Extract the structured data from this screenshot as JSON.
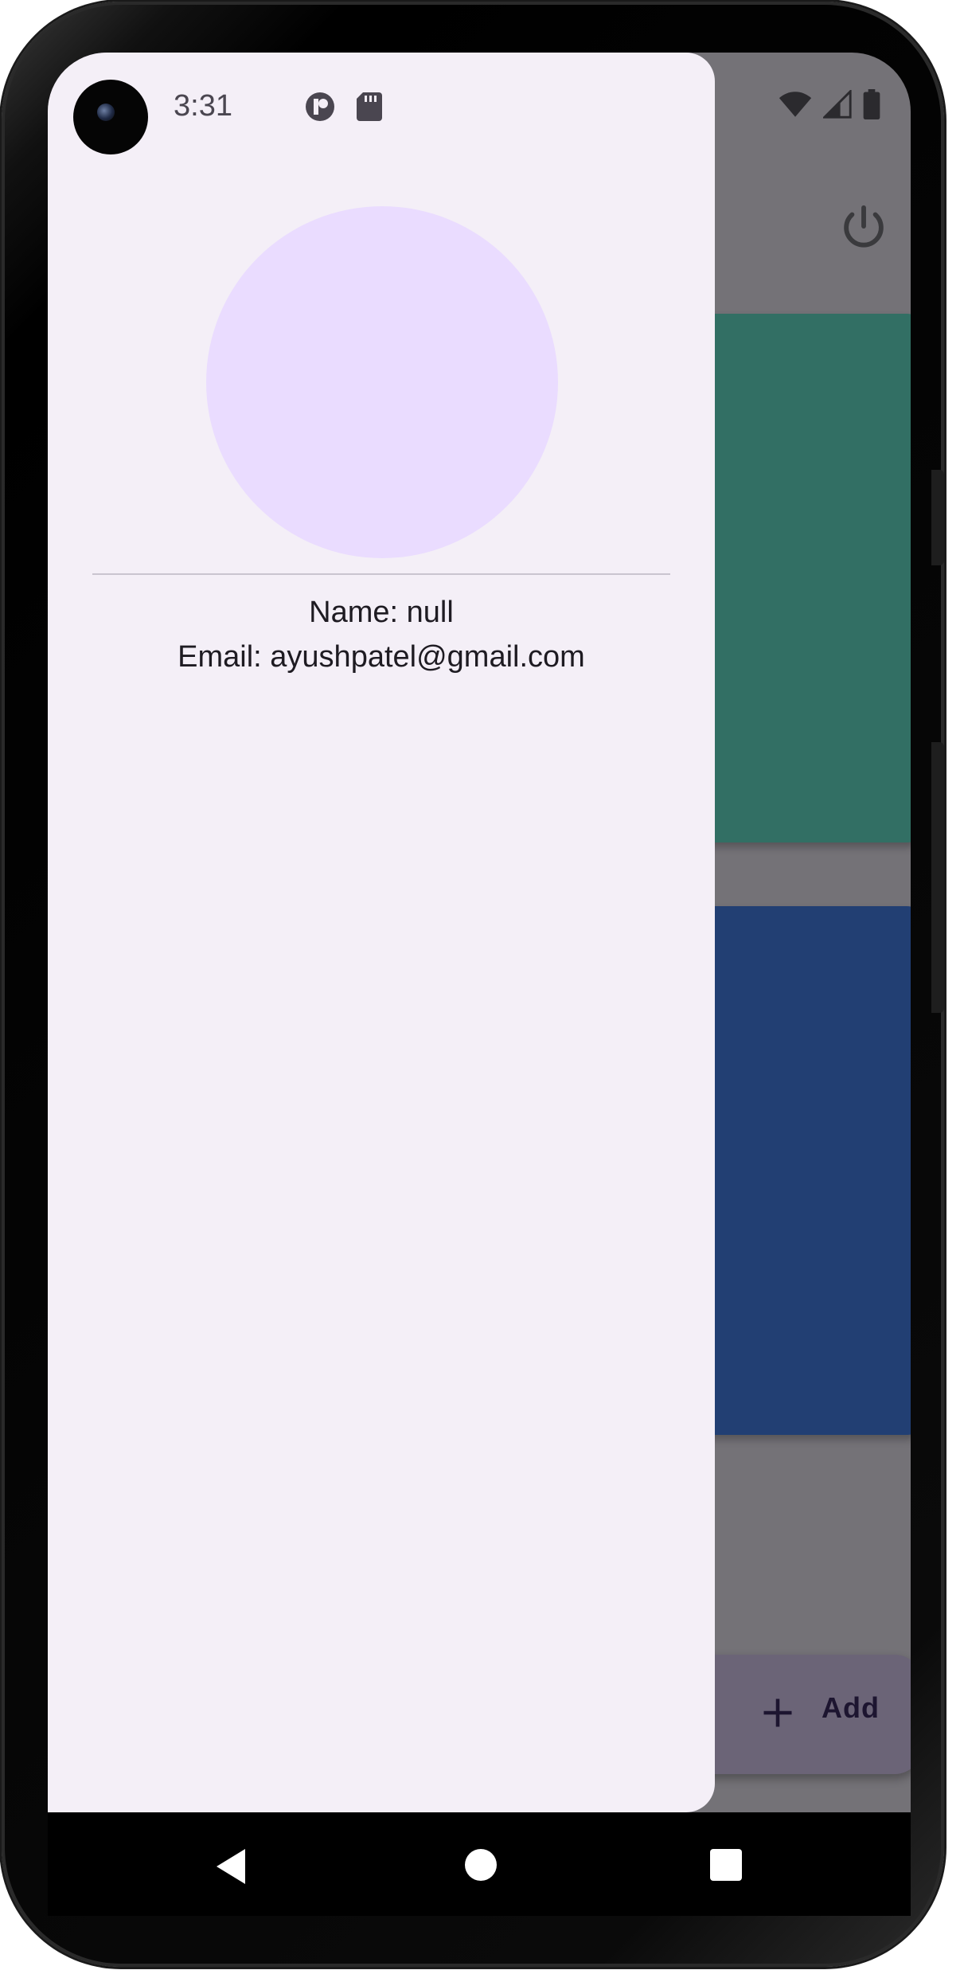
{
  "status_bar": {
    "time": "3:31",
    "left_icons": [
      "app-notification-icon",
      "sd-card-icon"
    ],
    "right_icons": [
      "wifi-icon",
      "cellular-signal-icon",
      "battery-icon"
    ]
  },
  "drawer": {
    "avatar": "profile-avatar",
    "name_line": "Name: null",
    "email_line": "Email: ayushpatel@gmail.com"
  },
  "background_app": {
    "top_action": "power-icon",
    "cards": [
      {
        "color": "#326f64"
      },
      {
        "color": "#223f73"
      }
    ],
    "fab": {
      "icon": "plus-icon",
      "label": "Add"
    }
  },
  "navigation_bar": {
    "buttons": [
      "back-button",
      "home-button",
      "recents-button"
    ]
  },
  "colors": {
    "drawer_background": "#f4eff7",
    "avatar_fill": "#eadcff",
    "scrim": "#747277",
    "fab_background": "#6b6477"
  }
}
